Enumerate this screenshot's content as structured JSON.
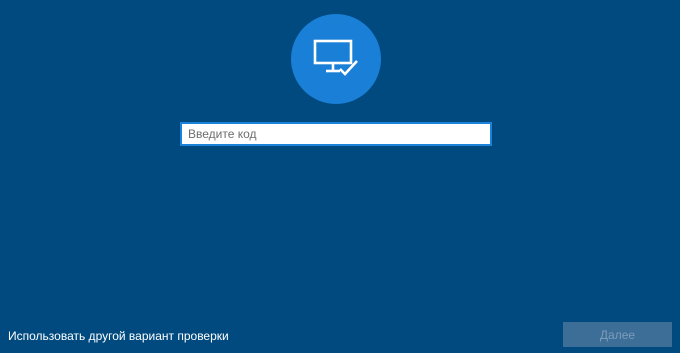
{
  "header": {
    "icon": "monitor-check-icon",
    "icon_color": "#ffffff",
    "circle_color": "#1a7fd6"
  },
  "code_field": {
    "value": "",
    "placeholder": "Введите код"
  },
  "footer": {
    "alt_verification_link": "Использовать другой вариант проверки",
    "next_button": {
      "label": "Далее",
      "enabled": false
    }
  },
  "colors": {
    "background": "#004a7f",
    "accent": "#1a82d8",
    "disabled_button": "#3d6e98"
  }
}
